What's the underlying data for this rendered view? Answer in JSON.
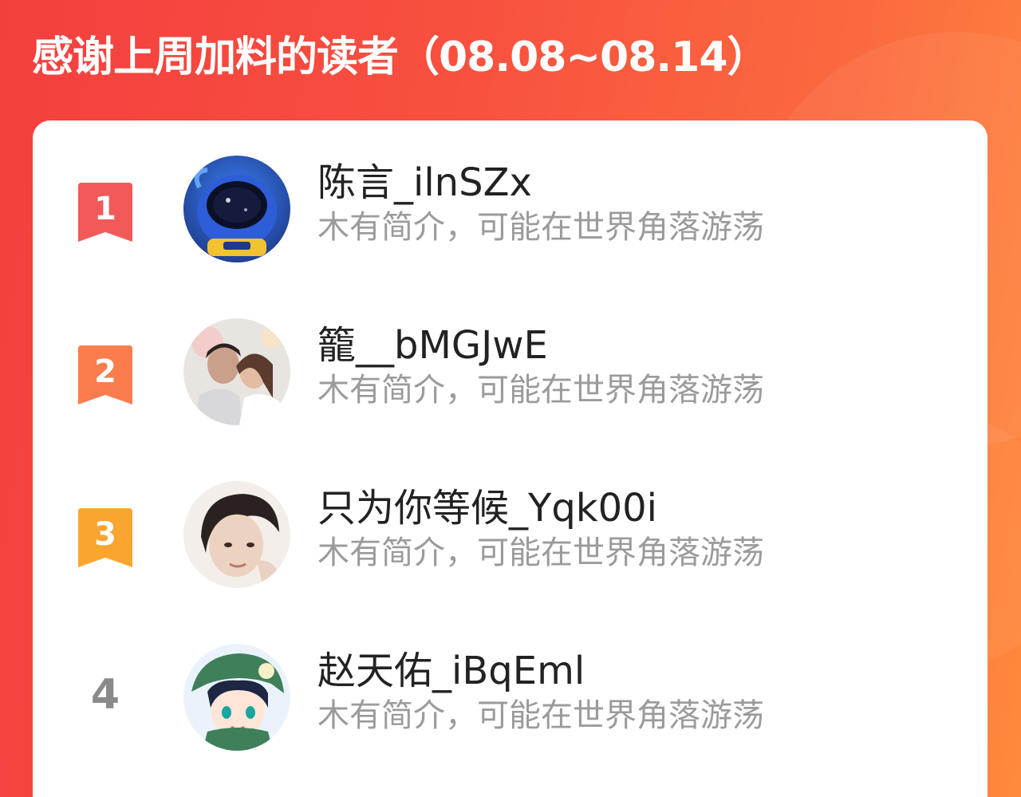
{
  "header": {
    "title": "感谢上周加料的读者（08.08~08.14）"
  },
  "colors": {
    "rank1": "#f25a5a",
    "rank2": "#fb7c4c",
    "rank3": "#fba531",
    "rank_plain": "#8a8a8a"
  },
  "readers": [
    {
      "rank": "1",
      "name": "陈言_ilnSZx",
      "bio": "木有简介，可能在世界角落游荡",
      "avatar_icon": "astronaut-avatar"
    },
    {
      "rank": "2",
      "name": "籠__bMGJwE",
      "bio": "木有简介，可能在世界角落游荡",
      "avatar_icon": "couple-photo-avatar"
    },
    {
      "rank": "3",
      "name": "只为你等候_Yqk00i",
      "bio": "木有简介，可能在世界角落游荡",
      "avatar_icon": "man-portrait-avatar"
    },
    {
      "rank": "4",
      "name": "赵天佑_iBqEml",
      "bio": "木有简介，可能在世界角落游荡",
      "avatar_icon": "anime-character-avatar"
    }
  ]
}
